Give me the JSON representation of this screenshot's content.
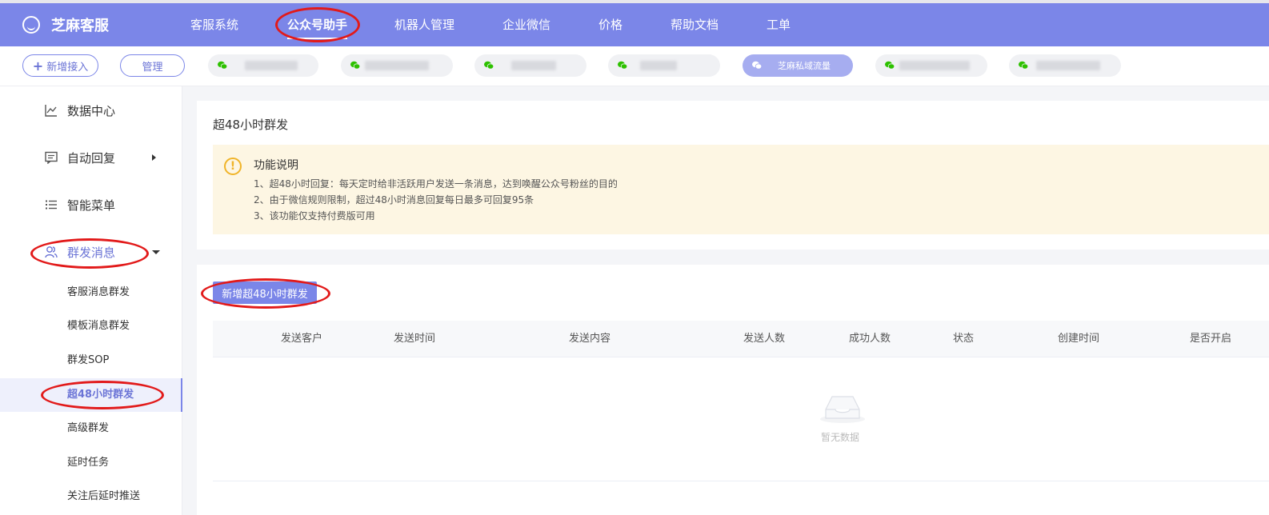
{
  "brand": {
    "name": "芝麻客服"
  },
  "nav": {
    "items": [
      {
        "label": "客服系统",
        "active": false
      },
      {
        "label": "公众号助手",
        "active": true
      },
      {
        "label": "机器人管理",
        "active": false
      },
      {
        "label": "企业微信",
        "active": false
      },
      {
        "label": "价格",
        "active": false
      },
      {
        "label": "帮助文档",
        "active": false
      },
      {
        "label": "工单",
        "active": false
      }
    ]
  },
  "account_bar": {
    "add_label": "新增接入",
    "manage_label": "管理",
    "active_account": "芝麻私域流量"
  },
  "sidebar": {
    "items": [
      {
        "label": "数据中心",
        "icon": "chart-icon"
      },
      {
        "label": "自动回复",
        "icon": "message-icon",
        "expandable": true
      },
      {
        "label": "智能菜单",
        "icon": "list-icon"
      },
      {
        "label": "群发消息",
        "icon": "users-icon",
        "expanded": true
      }
    ],
    "sub_items": [
      {
        "label": "客服消息群发"
      },
      {
        "label": "模板消息群发"
      },
      {
        "label": "群发SOP"
      },
      {
        "label": "超48小时群发",
        "active": true
      },
      {
        "label": "高级群发"
      },
      {
        "label": "延时任务"
      },
      {
        "label": "关注后延时推送"
      }
    ]
  },
  "main": {
    "title": "超48小时群发",
    "notice": {
      "title": "功能说明",
      "lines": [
        "1、超48小时回复：每天定时给非活跃用户发送一条消息，达到唤醒公众号粉丝的目的",
        "2、由于微信规则限制，超过48小时消息回复每日最多可回复95条",
        "3、该功能仅支持付费版可用"
      ]
    },
    "add_button": "新增超48小时群发",
    "table": {
      "columns": [
        "发送客户",
        "发送时间",
        "发送内容",
        "发送人数",
        "成功人数",
        "状态",
        "创建时间",
        "是否开启"
      ],
      "rows": [],
      "empty_text": "暂无数据"
    }
  },
  "colors": {
    "accent": "#7b86e8",
    "annotation": "#e21a1a",
    "notice_bg": "#fdf6e3",
    "warning": "#f0b429"
  }
}
